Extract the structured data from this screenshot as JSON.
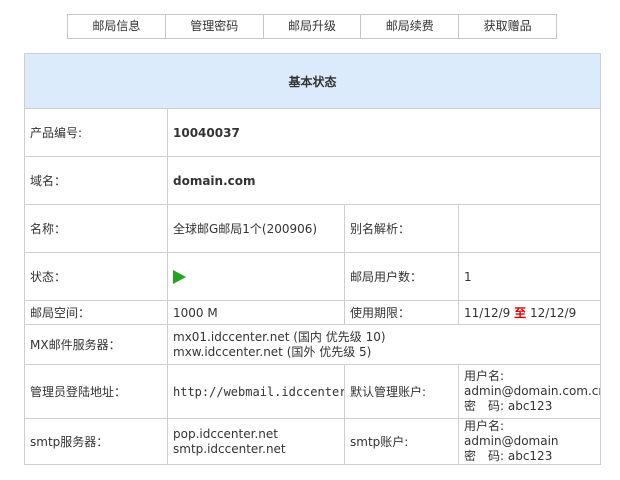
{
  "tabs": [
    "邮局信息",
    "管理密码",
    "邮局升级",
    "邮局续费",
    "获取赠品"
  ],
  "panel": {
    "title": "基本状态",
    "product_no_label": "产品编号:",
    "product_no": "10040037",
    "domain_label": "域名：",
    "domain": "domain.com",
    "name_label": "名称：",
    "name": "全球邮G邮局1个(200906)",
    "alias_label": "别名解析：",
    "alias": "",
    "status_label": "状态：",
    "status_icon": "play-icon",
    "users_label": "邮局用户数：",
    "users": "1",
    "space_label": "邮局空间：",
    "space": "1000 M",
    "period_label": "使用期限：",
    "period_start": "11/12/9",
    "period_to": "至",
    "period_end": "12/12/9",
    "mx_label": "MX邮件服务器：",
    "mx1": "mx01.idccenter.net (国内 优先级 10)",
    "mx2": "mxw.idccenter.net (国外 优先级 5)",
    "admin_url_label": "管理员登陆地址：",
    "admin_url": "http://webmail.idccenter.net",
    "default_admin_label": "默认管理账户:",
    "default_admin_user_label": "用户名:",
    "default_admin_user": "admin@domain.com.cn",
    "default_admin_pass": "密　码: abc123",
    "smtp_server_label": "smtp服务器：",
    "pop_server": "pop.idccenter.net",
    "smtp_server": "smtp.idccenter.net",
    "smtp_account_label": "smtp账户:",
    "smtp_user": "用户名: admin@domain",
    "smtp_pass": "密　码: abc123"
  },
  "colors": {
    "header_bg": "#dcebfb",
    "domain": "#e00000",
    "status_icon": "#22a322"
  }
}
